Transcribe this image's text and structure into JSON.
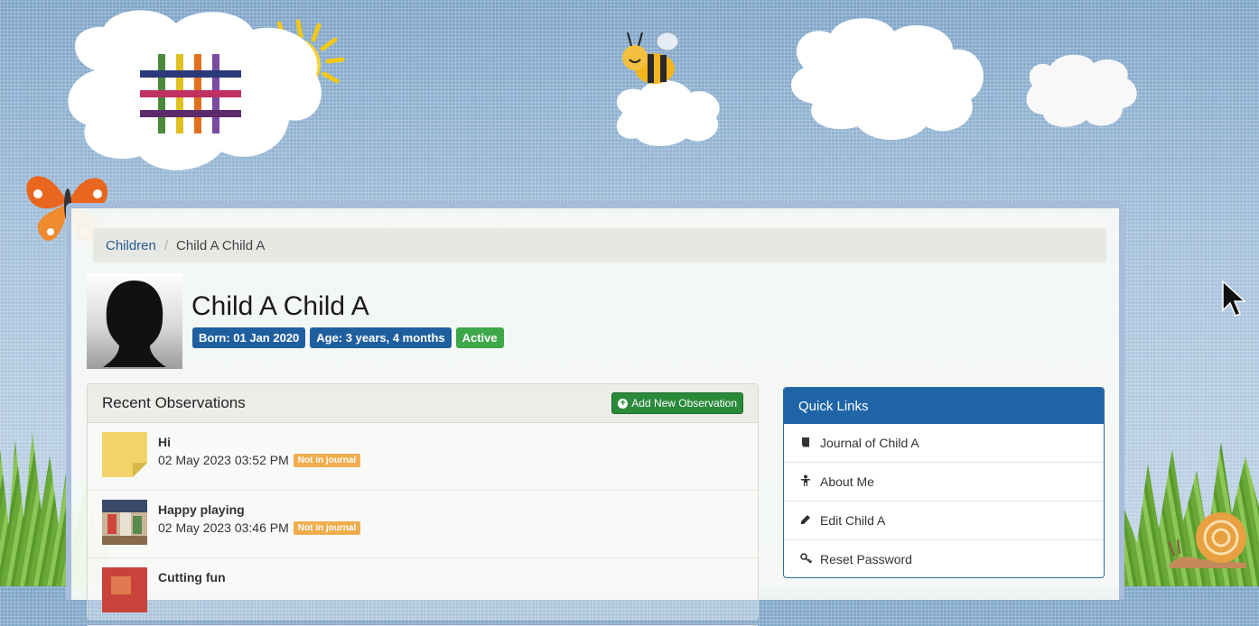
{
  "breadcrumb": {
    "parent": "Children",
    "separator": "/",
    "current": "Child A Child A"
  },
  "profile": {
    "name": "Child A Child A",
    "born": "Born: 01 Jan 2020",
    "age": "Age: 3 years, 4 months",
    "status": "Active"
  },
  "observations": {
    "title": "Recent Observations",
    "add_label": "Add New Observation",
    "items": [
      {
        "title": "Hi",
        "date": "02 May 2023 03:52 PM",
        "tag": "Not in journal"
      },
      {
        "title": "Happy playing",
        "date": "02 May 2023 03:46 PM",
        "tag": "Not in journal"
      },
      {
        "title": "Cutting fun",
        "date": "",
        "tag": ""
      }
    ]
  },
  "quick_links": {
    "title": "Quick Links",
    "items": [
      {
        "label": "Journal of Child A",
        "icon": "book-icon"
      },
      {
        "label": "About Me",
        "icon": "person-icon"
      },
      {
        "label": "Edit Child A",
        "icon": "pencil-icon"
      },
      {
        "label": "Reset Password",
        "icon": "key-icon"
      }
    ]
  },
  "colors": {
    "primary": "#1f65a8",
    "badge_blue": "#1f5fa0",
    "success": "#3da84a",
    "warning": "#f0ad4e"
  }
}
